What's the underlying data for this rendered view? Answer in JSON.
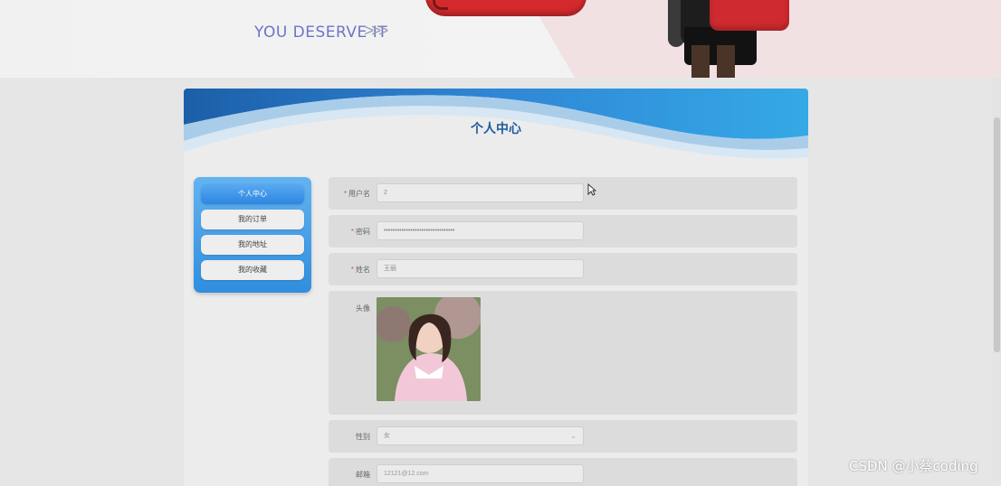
{
  "banner": {
    "slogan": "YOU DESERVE IT",
    "arrows": ">>>"
  },
  "page": {
    "title": "个人中心"
  },
  "sidebar": {
    "items": [
      {
        "label": "个人中心",
        "active": true
      },
      {
        "label": "我的订单",
        "active": false
      },
      {
        "label": "我的地址",
        "active": false
      },
      {
        "label": "我的收藏",
        "active": false
      }
    ]
  },
  "form": {
    "username": {
      "label": "用户名",
      "value": "2",
      "required": true
    },
    "password": {
      "label": "密码",
      "value": "••••••••••••••••••••••••••••••••",
      "required": true
    },
    "name": {
      "label": "姓名",
      "value": "王丽",
      "required": true
    },
    "avatar": {
      "label": "头像"
    },
    "gender": {
      "label": "性别",
      "value": "女"
    },
    "email": {
      "label": "邮箱",
      "value": "12121@12.com"
    }
  },
  "required_mark": "*",
  "select_caret": "⌄",
  "watermark": "CSDN @小蔡coding",
  "colors": {
    "accent": "#2f8ede",
    "title": "#1f5aa0",
    "required": "#e05050"
  }
}
